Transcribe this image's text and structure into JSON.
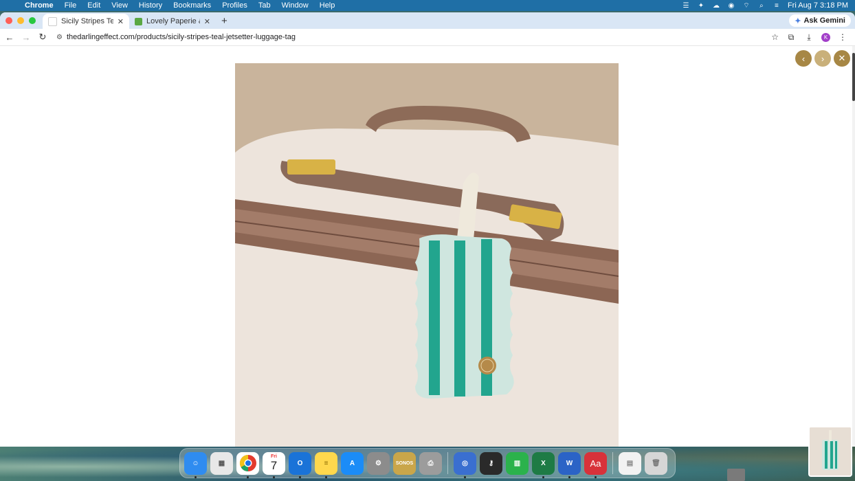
{
  "menubar": {
    "app_name": "Chrome",
    "items": [
      "File",
      "Edit",
      "View",
      "History",
      "Bookmarks",
      "Profiles",
      "Tab",
      "Window",
      "Help"
    ],
    "clock": "Fri Aug 7  3:18 PM"
  },
  "tabs": [
    {
      "title": "Sicily Stripes Teal Jetsetter L",
      "active": true
    },
    {
      "title": "Lovely Paperie & Gifts - Produ",
      "active": false
    }
  ],
  "gemini": {
    "label": "Ask Gemini"
  },
  "omnibox": {
    "url": "thedarlingeffect.com/products/sicily-stripes-teal-jetsetter-luggage-tag"
  },
  "profile": {
    "initial": "K"
  },
  "gallery": {
    "prev_icon": "chevron-left-icon",
    "next_icon": "chevron-right-icon",
    "close_icon": "close-icon"
  },
  "dock": {
    "apps": [
      {
        "name": "finder",
        "color": "#2f8cf0"
      },
      {
        "name": "launchpad",
        "color": "#e8e8e8"
      },
      {
        "name": "chrome",
        "color": "#ffffff"
      },
      {
        "name": "calendar",
        "color": "#ffffff",
        "text": "7",
        "subtext": "Fri"
      },
      {
        "name": "outlook",
        "color": "#1a73d8"
      },
      {
        "name": "notes",
        "color": "#ffd84d"
      },
      {
        "name": "app-store",
        "color": "#1b8cf7"
      },
      {
        "name": "system-settings",
        "color": "#8c8c8c"
      },
      {
        "name": "sonos",
        "color": "#c9a64a",
        "text": "SONOS"
      },
      {
        "name": "printer",
        "color": "#9c9c9c"
      }
    ],
    "apps2": [
      {
        "name": "ai-assistant",
        "color": "#3a6fd0"
      },
      {
        "name": "keychain",
        "color": "#2a2a2a"
      },
      {
        "name": "numbers",
        "color": "#2bb24c"
      },
      {
        "name": "excel",
        "color": "#1e7b45"
      },
      {
        "name": "word",
        "color": "#2b63c6"
      },
      {
        "name": "dictionary",
        "color": "#d8323a",
        "text": "Aa"
      }
    ],
    "apps3": [
      {
        "name": "files",
        "color": "#f2f2f2"
      },
      {
        "name": "trash",
        "color": "#d6d6d6"
      }
    ]
  }
}
